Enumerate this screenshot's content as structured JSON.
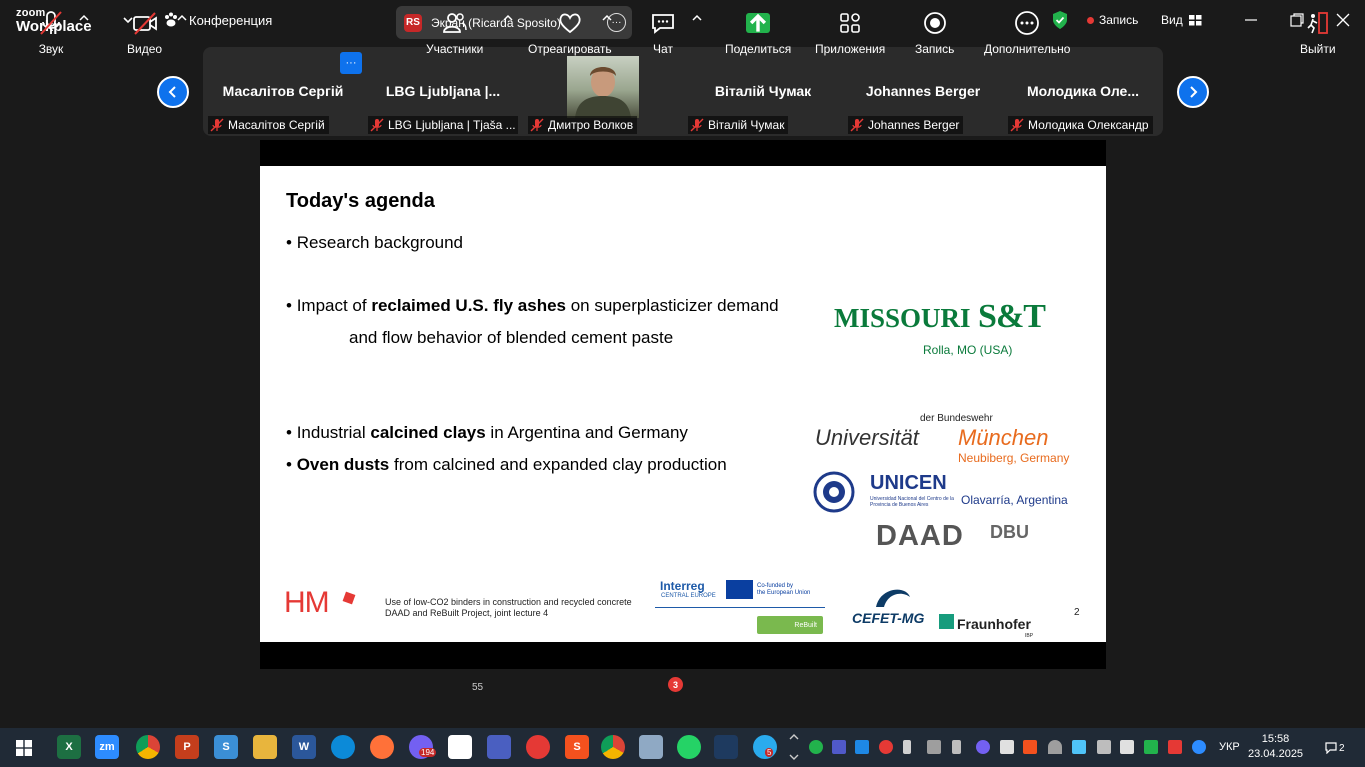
{
  "app": {
    "logo_line1": "zoom",
    "logo_line2": "Workplace",
    "meeting_title": "Конференция",
    "screen_share": "Экран (Ricarda Sposito)",
    "screen_share_initials": "RS",
    "recording_label": "Запись",
    "view_label": "Вид"
  },
  "participants": [
    {
      "big": "Масалітов Сергій",
      "tag": "Масалітов Сергій"
    },
    {
      "big": "LBG  Ljubljana |...",
      "tag": "LBG Ljubljana | Tjaša ..."
    },
    {
      "big": "",
      "tag": "Дмитро Волков"
    },
    {
      "big": "Віталій Чумак",
      "tag": "Віталій Чумак"
    },
    {
      "big": "Johannes Berger",
      "tag": "Johannes Berger"
    },
    {
      "big": "Молодика  Оле...",
      "tag": "Молодика Олександр"
    }
  ],
  "slide": {
    "title": "Today's agenda",
    "b1": "Research background",
    "b2_pre": "Impact of ",
    "b2_bold": "reclaimed U.S. fly ashes",
    "b2_post": " on superplasticizer demand",
    "b2_line2": "and flow behavior of blended cement paste",
    "b3_pre": "Industrial ",
    "b3_bold": "calcined clays",
    "b3_post": " in Argentina and Germany",
    "b4_bold": "Oven dusts",
    "b4_post": " from calcined and expanded clay production",
    "bullet": "•",
    "missouri": "MISSOURI",
    "st": "S&T",
    "rolla": "Rolla, MO (USA)",
    "bundeswehr": "der Bundeswehr",
    "universitaet": "Universität",
    "muenchen": "München",
    "neubiberg": "Neubiberg, Germany",
    "unicen": "UNICEN",
    "unicen_sub": "Universidad Nacional del Centro de la Provincia de Buenos Aires",
    "olavarria": "Olavarría, Argentina",
    "daad": "DAAD",
    "dbu": "DBU",
    "hm": "HM",
    "footer_l1": "Use of low-CO2 binders in construction and recycled concrete",
    "footer_l2": "DAAD and ReBuilt Project, joint lecture 4",
    "interreg": "Interreg",
    "interreg_sub": "CENTRAL EUROPE",
    "eu_l1": "Co-funded by",
    "eu_l2": "the European Union",
    "rebuilt": "ReBuilt",
    "cefet": "CEFET-MG",
    "fraunhofer": "Fraunhofer",
    "ibp": "IBP",
    "page": "2"
  },
  "toolbar": {
    "audio": "Звук",
    "video": "Видео",
    "participants": "Участники",
    "participants_count": "55",
    "react": "Отреагировать",
    "chat": "Чат",
    "chat_badge": "3",
    "share": "Поделиться",
    "apps": "Приложения",
    "record": "Запись",
    "more": "Дополнительно",
    "leave": "Выйти"
  },
  "taskbar": {
    "viber_badge": "194",
    "telegram_badge": "5",
    "lang": "УКР",
    "time": "15:58",
    "date": "23.04.2025",
    "notif": "2",
    "zoom_label": "zm"
  },
  "colors": {
    "accent_blue": "#0e72ed",
    "share_green": "#22b24c",
    "missouri_green": "#0a7a3b",
    "muenchen_orange": "#e86b1e",
    "unicen_blue": "#1e3a8a",
    "record_red": "#e53935"
  }
}
